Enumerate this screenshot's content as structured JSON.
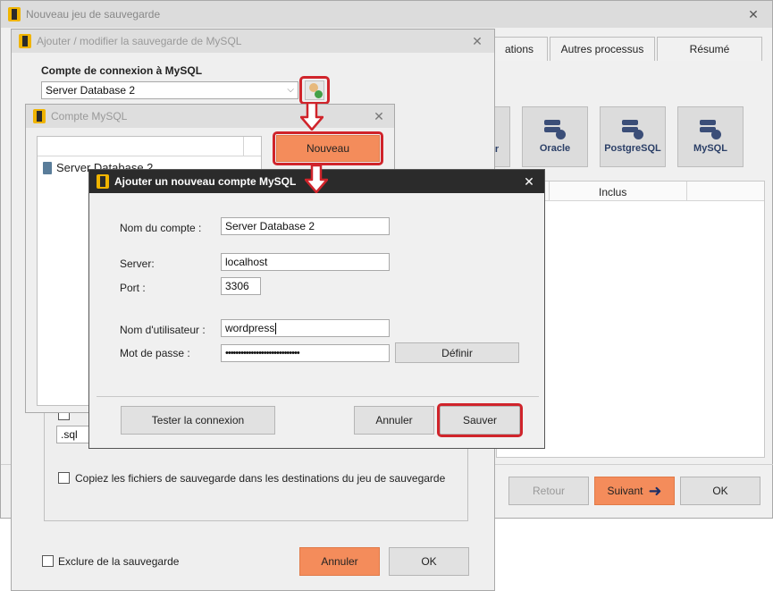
{
  "main_window": {
    "title": "Nouveau jeu de sauvegarde",
    "tabs": [
      "ations",
      "Autres processus",
      "Résumé"
    ],
    "db_tiles": [
      {
        "label": "er",
        "icon": "database-plus-icon"
      },
      {
        "label": "Oracle",
        "icon": "database-plus-icon"
      },
      {
        "label": "PostgreSQL",
        "icon": "database-plus-icon"
      },
      {
        "label": "MySQL",
        "icon": "database-plus-icon"
      }
    ],
    "table_header_inclus": "Inclus",
    "buttons": {
      "retour": "Retour",
      "suivant": "Suivant",
      "ok": "OK"
    }
  },
  "mysql_dialog": {
    "title": "Ajouter / modifier la sauvegarde de MySQL",
    "account_label": "Compte de connexion à MySQL",
    "account_value": "Server Database 2",
    "ext_value": ".sql",
    "copy_label": "Copiez les fichiers de sauvegarde dans les destinations du jeu de sauvegarde",
    "exclude_label": "Exclure de la sauvegarde",
    "cancel": "Annuler",
    "ok": "OK"
  },
  "account_dialog": {
    "title": "Compte MySQL",
    "list_item": "Server Database 2",
    "new_button": "Nouveau"
  },
  "new_account_dialog": {
    "title": "Ajouter un nouveau compte MySQL",
    "account_name_label": "Nom du compte :",
    "account_name_value": "Server Database 2",
    "server_label": "Server:",
    "server_value": "localhost",
    "port_label": "Port :",
    "port_value": "3306",
    "user_label": "Nom d'utilisateur :",
    "user_value": "wordpress",
    "password_label": "Mot de passe :",
    "password_value": "•••••••••••••••••••••••••••••",
    "define_button": "Définir",
    "test_button": "Tester la connexion",
    "cancel_button": "Annuler",
    "save_button": "Sauver"
  },
  "colors": {
    "accent": "#f48c5b",
    "highlight": "#d0242b"
  }
}
